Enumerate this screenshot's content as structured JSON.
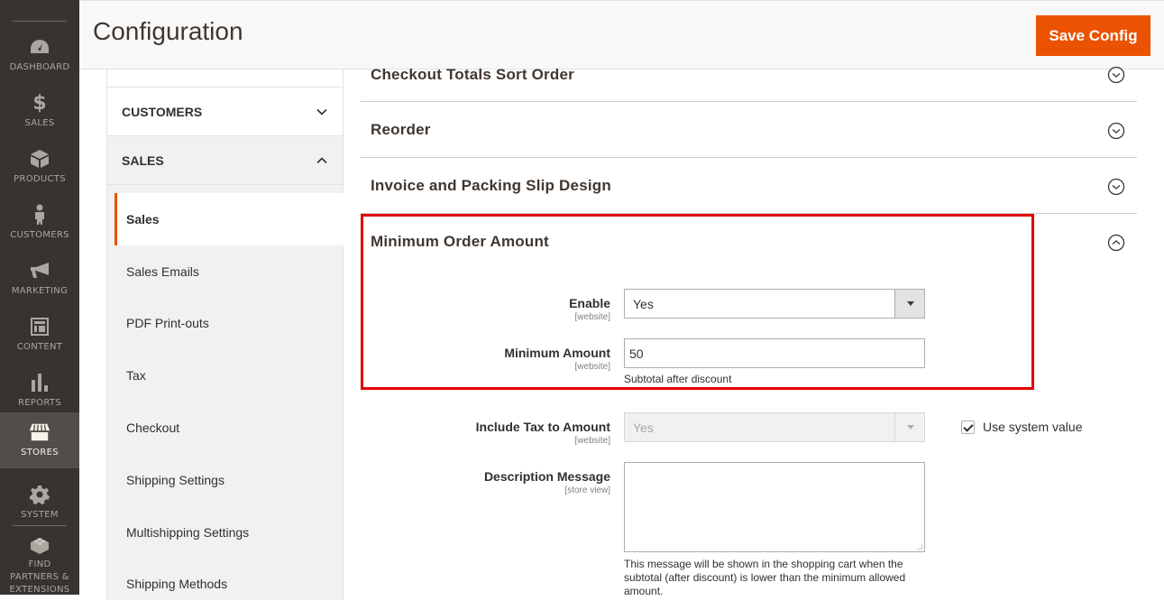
{
  "admin_nav": {
    "items": [
      {
        "label": "Dashboard",
        "icon": "dashboard-icon",
        "active": false
      },
      {
        "label": "Sales",
        "icon": "dollar-icon",
        "active": false
      },
      {
        "label": "Products",
        "icon": "box-icon",
        "active": false
      },
      {
        "label": "Customers",
        "icon": "person-icon",
        "active": false
      },
      {
        "label": "Marketing",
        "icon": "megaphone-icon",
        "active": false
      },
      {
        "label": "Content",
        "icon": "layout-icon",
        "active": false
      },
      {
        "label": "Reports",
        "icon": "bar-chart-icon",
        "active": false
      },
      {
        "label": "Stores",
        "icon": "store-icon",
        "active": true
      },
      {
        "label": "System",
        "icon": "gear-icon",
        "active": false
      },
      {
        "label": "Find Partners & Extensions",
        "icon": "lego-brick-icon",
        "active": false
      }
    ]
  },
  "header": {
    "title": "Configuration",
    "save_label": "Save Config",
    "accent_color": "#eb5202"
  },
  "config_nav": {
    "sections": [
      {
        "label": "CUSTOMERS",
        "expanded": false
      },
      {
        "label": "SALES",
        "expanded": true
      }
    ],
    "sales_items": [
      {
        "label": "Sales",
        "active": true
      },
      {
        "label": "Sales Emails",
        "active": false
      },
      {
        "label": "PDF Print-outs",
        "active": false
      },
      {
        "label": "Tax",
        "active": false
      },
      {
        "label": "Checkout",
        "active": false
      },
      {
        "label": "Shipping Settings",
        "active": false
      },
      {
        "label": "Multishipping Settings",
        "active": false
      },
      {
        "label": "Shipping Methods",
        "active": false
      }
    ]
  },
  "groups": [
    {
      "title": "Checkout Totals Sort Order",
      "expanded": false
    },
    {
      "title": "Reorder",
      "expanded": false
    },
    {
      "title": "Invoice and Packing Slip Design",
      "expanded": false
    },
    {
      "title": "Minimum Order Amount",
      "expanded": true
    }
  ],
  "minimum_order": {
    "enable": {
      "label": "Enable",
      "scope": "[website]",
      "value": "Yes"
    },
    "minimum_amount": {
      "label": "Minimum Amount",
      "scope": "[website]",
      "value": "50",
      "note": "Subtotal after discount"
    },
    "include_tax": {
      "label": "Include Tax to Amount",
      "scope": "[website]",
      "value": "Yes",
      "disabled": true,
      "use_system_value_label": "Use system value",
      "use_system_value_checked": true
    },
    "description": {
      "label": "Description Message",
      "scope": "[store view]",
      "value": "",
      "note": "This message will be shown in the shopping cart when the subtotal (after discount) is lower than the minimum allowed amount."
    }
  },
  "highlight_color": "#e30000"
}
